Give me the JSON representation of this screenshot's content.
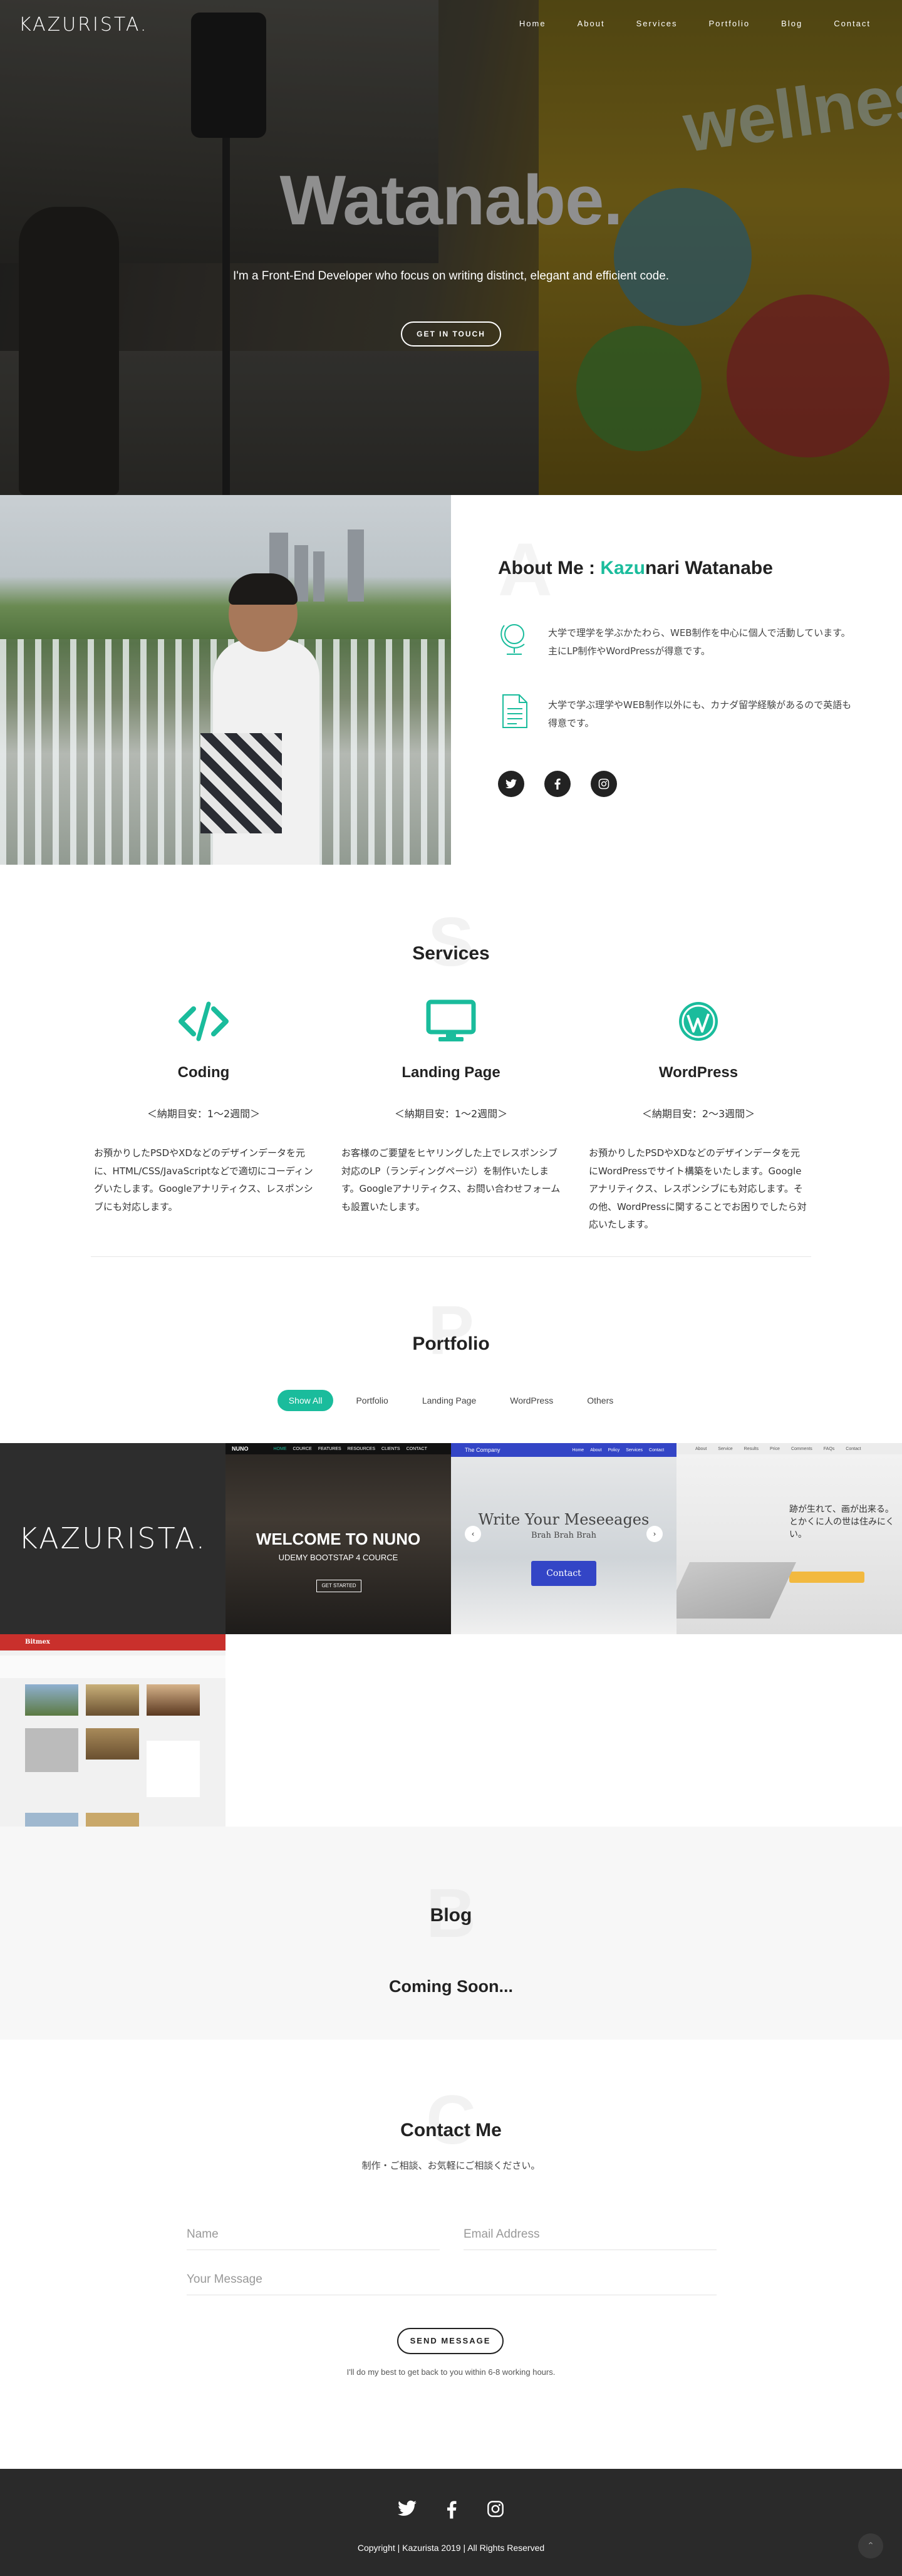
{
  "brand": {
    "logo": "KAZURISTA."
  },
  "nav": {
    "items": [
      "Home",
      "About",
      "Services",
      "Portfolio",
      "Blog",
      "Contact"
    ]
  },
  "hero": {
    "title": "Watanabe.",
    "subtitle": "I'm a Front-End Developer who focus on writing distinct, elegant and efficient code.",
    "button": "GET IN TOUCH",
    "bg_text": "wellness"
  },
  "about": {
    "ghost_letter": "A",
    "heading_prefix": "About Me : ",
    "heading_accent": "Kazu",
    "heading_suffix": "nari Watanabe",
    "items": [
      {
        "icon": "globe-icon",
        "text": "大学で理学を学ぶかたわら、WEB制作を中心に個人で活動しています。主にLP制作やWordPressが得意です。"
      },
      {
        "icon": "document-icon",
        "text": "大学で学ぶ理学やWEB制作以外にも、カナダ留学経験があるので英語も得意です。"
      }
    ],
    "socials": [
      "twitter-icon",
      "facebook-icon",
      "instagram-icon"
    ]
  },
  "services": {
    "ghost_letter": "S",
    "title": "Services",
    "items": [
      {
        "icon": "code-icon",
        "name": "Coding",
        "term": "＜納期目安：1〜2週間＞",
        "desc": "お預かりしたPSDやXDなどのデザインデータを元に、HTML/CSS/JavaScriptなどで適切にコーディングいたします。Googleアナリティクス、レスポンシブにも対応します。"
      },
      {
        "icon": "monitor-icon",
        "name": "Landing Page",
        "term": "＜納期目安：1〜2週間＞",
        "desc": "お客様のご要望をヒヤリングした上でレスポンシブ対応のLP（ランディングページ）を制作いたします。Googleアナリティクス、お問い合わせフォームも設置いたします。"
      },
      {
        "icon": "wordpress-icon",
        "name": "WordPress",
        "term": "＜納期目安：2〜3週間＞",
        "desc": "お預かりしたPSDやXDなどのデザインデータを元にWordPressでサイト構築をいたします。Googleアナリティクス、レスポンシブにも対応します。その他、WordPressに関することでお困りでしたら対応いたします。"
      }
    ]
  },
  "portfolio": {
    "ghost_letter": "P",
    "title": "Portfolio",
    "filters": [
      "Show All",
      "Portfolio",
      "Landing Page",
      "WordPress",
      "Others"
    ],
    "active_filter": "Show All",
    "items": [
      {
        "label": "KAZURISTA."
      },
      {
        "label": "WELCOME TO NUNO",
        "sub": "UDEMY BOOTSTAP 4 COURCE",
        "cta": "GET STARTED",
        "brand": "NUNO",
        "menu": [
          "HOME",
          "COURCE",
          "FEATURES",
          "RESOURCES",
          "CLIENTS",
          "CONTACT"
        ]
      },
      {
        "label": "Write Your Meseeages",
        "sub": "Brah Brah Brah",
        "cta": "Contact",
        "brand": "The Company",
        "menu": [
          "Home",
          "About",
          "Policy",
          "Services",
          "Contact"
        ]
      },
      {
        "label": "跡が生れて、画が出来る。",
        "sub": "とかくに人の世は住みにくい。",
        "menu": [
          "About",
          "Service",
          "Results",
          "Price",
          "Comments",
          "FAQs",
          "Contact"
        ]
      },
      {
        "label": "Bitmex"
      }
    ]
  },
  "blog": {
    "ghost_letter": "B",
    "title": "Blog",
    "status": "Coming Soon..."
  },
  "contact": {
    "ghost_letter": "C",
    "title": "Contact Me",
    "intro": "制作・ご相談、お気軽にご相談ください。",
    "name_placeholder": "Name",
    "email_placeholder": "Email Address",
    "message_placeholder": "Your Message",
    "button": "SEND MESSAGE",
    "note": "I'll do my best to get back to you within 6-8 working hours."
  },
  "footer": {
    "socials": [
      "twitter-icon",
      "facebook-icon",
      "instagram-icon"
    ],
    "copyright": "Copyright | Kazurista 2019 | All Rights Reserved"
  },
  "colors": {
    "accent": "#1abc9c",
    "dark": "#222222",
    "footer": "#2a2a2a"
  }
}
